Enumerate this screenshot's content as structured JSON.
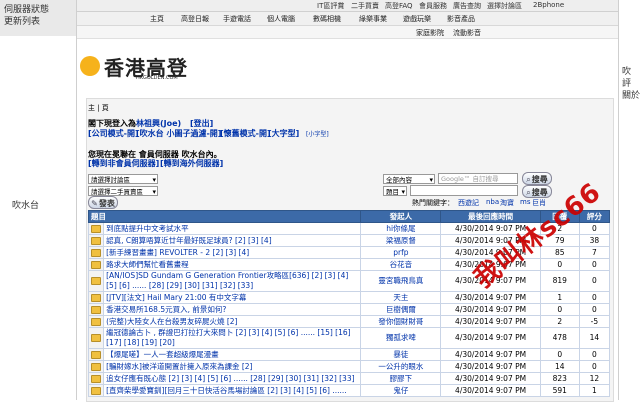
{
  "left": {
    "top_items": [
      "伺服器狀態",
      "更新列表"
    ],
    "mid_item": "吹水台"
  },
  "right": {
    "items": [
      "吹",
      "評",
      "關於"
    ]
  },
  "topbar": {
    "items": [
      "IT區評賞",
      "二手買賣",
      "高登FAQ",
      "會員服務",
      "廣告查詢",
      "選擇討論區",
      "2Bphone"
    ]
  },
  "navbar": {
    "items": [
      "主頁",
      "高登日報",
      "手遊電話",
      "個人電腦",
      "數碼相機",
      "綠樂事業",
      "遊戲玩樂",
      "影音產品"
    ]
  },
  "subnav": {
    "items": [
      "家庭影院",
      "流動影音"
    ]
  },
  "logo": {
    "text": "香港高登",
    "sub": "HKGOLDEN.COM"
  },
  "panel": {
    "breadcrumb": "主 | 頁",
    "welcome_prefix": "閣下現登入為",
    "username": "林祖興(Joe)",
    "logout": "[登出]",
    "modes": [
      "[公司模式-開]",
      "[吹水台 小圖子過濾-開]",
      "[懷舊模式-開]",
      "[大字型]"
    ],
    "small_font": "[小字型]",
    "server_line": "您現在冕聯在 會員伺服器 吹水台內。",
    "server_links": [
      "[轉到非會員伺服器]",
      "[轉到海外伺服器]"
    ],
    "select1": "請選擇討論區",
    "select2": "請選擇二手買賣區",
    "content_select": "全部內容",
    "search_placeholder": "Google™ 自訂搜尋",
    "title_select": "題目",
    "search_btn": "搜尋",
    "hot_label": "熱門關鍵字：",
    "hot_keywords": [
      "西遊記",
      "nba",
      "淘寶",
      "ms",
      "巨肖"
    ],
    "post_btn": "發表"
  },
  "table": {
    "headers": [
      "題目",
      "發起人",
      "最後回應時間",
      "回覆",
      "評分"
    ],
    "rows": [
      {
        "title": "到底點提升中文考試水平",
        "author": "hi你條尾",
        "time": "4/30/2014  9:07 PM",
        "replies": "2",
        "score": "0"
      },
      {
        "title": "認真, C朗算唔算近廿年最好既足球員? [2] [3] [4]",
        "author": "梁福原督",
        "time": "4/30/2014  9:07 PM",
        "replies": "79",
        "score": "38"
      },
      {
        "title": "[新手練習畫畫] REVOLTER - 2 [2] [3] [4]",
        "author": "prfp",
        "time": "4/30/2014  9:07 PM",
        "replies": "85",
        "score": "7"
      },
      {
        "title": "路求大師們幫忙看舊畫程",
        "author": "谷花音",
        "time": "4/30/2014  9:07 PM",
        "replies": "0",
        "score": "0"
      },
      {
        "title": "[AN/IOS]SD Gundam G Generation Frontier攻略區[636] [2] [3] [4] [5] [6] ...... [28] [29] [30] [31] [32] [33]",
        "author": "靈宮職飛鳥真",
        "time": "4/30/2014  9:07 PM",
        "replies": "819",
        "score": "0",
        "tall": true
      },
      {
        "title": "[JTV][法文] Hail Mary 21:00 有中文字幕",
        "author": "天主",
        "time": "4/30/2014  9:07 PM",
        "replies": "1",
        "score": "0"
      },
      {
        "title": "香港交易所168.5元買入, 前景如何?",
        "author": "巨樹偶爾",
        "time": "4/30/2014  9:07 PM",
        "replies": "0",
        "score": "0"
      },
      {
        "title": "(完整)大陸女人在台殺男友碎屍火燒 [2]",
        "author": "發你個財財哥",
        "time": "4/30/2014  9:07 PM",
        "replies": "2",
        "score": "-5"
      },
      {
        "title": "繼冠德論古卜 , 群證巴打拉打大來問卜 [2] [3] [4] [5] [6] ...... [15] [16] [17] [18] [19] [20]",
        "author": "獨孤求啤",
        "time": "4/30/2014  9:07 PM",
        "replies": "478",
        "score": "14",
        "tall": true
      },
      {
        "title": "【爆尾嗟】一人一套超級爆尾漫畫",
        "author": "暴徒",
        "time": "4/30/2014  9:07 PM",
        "replies": "0",
        "score": "0"
      },
      {
        "title": "[騙財嫁水]被洋道開置計擁入原來為課金 [2]",
        "author": "一公升的眼水",
        "time": "4/30/2014  9:07 PM",
        "replies": "14",
        "score": "0"
      },
      {
        "title": "追女仔應有既心態 [2] [3] [4] [5] [6] ...... [28] [29] [30] [31] [32] [33]",
        "author": "膠膠下",
        "time": "4/30/2014  9:07 PM",
        "replies": "823",
        "score": "12"
      },
      {
        "title": "[直齊柴學愛寶釧][回月三十日快活谷馬場討論區 [2] [3] [4] [5] [6] ......",
        "author": "鬼仔",
        "time": "4/30/2014  9:07 PM",
        "replies": "591",
        "score": "1"
      }
    ]
  },
  "watermark": "我叫林sc66"
}
